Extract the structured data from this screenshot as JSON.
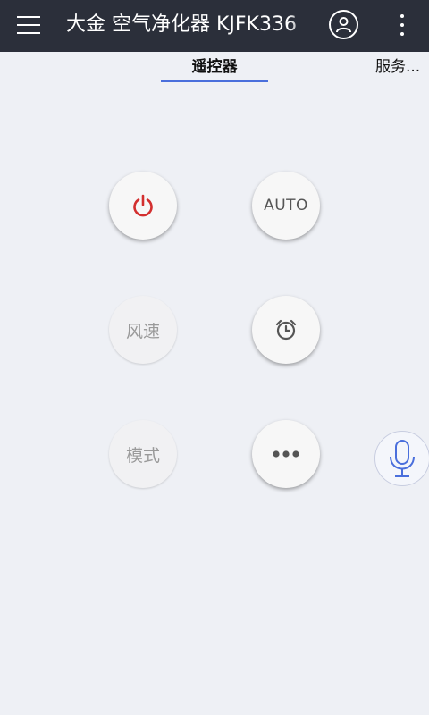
{
  "appbar": {
    "title": "大金 空气净化器 KJFK336",
    "menu_icon": "hamburger-menu-icon",
    "account_icon": "account-circle-icon",
    "more_icon": "more-vert-icon"
  },
  "tabs": [
    {
      "label": "遥控器",
      "selected": true
    },
    {
      "label": "服务..."
    }
  ],
  "remote": {
    "power_icon": "power-icon",
    "power_color": "#d32f2f",
    "auto_label": "AUTO",
    "fan_speed_label": "风速",
    "timer_icon": "alarm-clock-icon",
    "mode_label": "模式",
    "more_icon": "more-horiz-icon",
    "voice_icon": "microphone-icon",
    "voice_color": "#4a6fdc"
  }
}
